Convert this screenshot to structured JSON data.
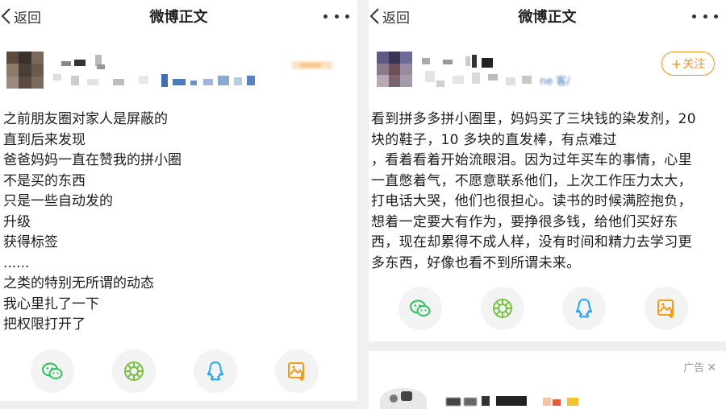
{
  "colors": {
    "accent": "#f7931e",
    "wechat": "#2cc35a",
    "moments": "#7ac142",
    "qq": "#1ea7f1",
    "save": "#f39c12"
  },
  "left": {
    "nav": {
      "back_label": "返回",
      "title": "微博正文"
    },
    "post_lines": [
      "之前朋友圈对家人是屏蔽的",
      "直到后来发现",
      "爸爸妈妈一直在赞我的拼小圈",
      "不是买的东西",
      "只是一些自动发的",
      "升级",
      "获得标签",
      "......",
      "之类的特别无所谓的动态",
      "我心里扎了一下",
      "把权限打开了"
    ],
    "share_icons": [
      "wechat-icon",
      "moments-icon",
      "qq-icon",
      "save-image-icon"
    ]
  },
  "right": {
    "nav": {
      "back_label": "返回",
      "title": "微博正文"
    },
    "follow_label": "关注",
    "follow_plus": "+",
    "source_fragment": "ne 客/",
    "post_lines": [
      "看到拼多多拼小圈里，妈妈买了三块钱的染发剂，20",
      "块的鞋子，10 多块的直发棒，有点难过",
      "，看着看着开始流眼泪。因为过年买车的事情，心里",
      "一直憋着气，不愿意联系他们，上次工作压力太大，",
      "打电话大哭，他们也很担心。读书的时候满腔抱负，",
      "想着一定要大有作为，要挣很多钱，给他们买好东",
      "西，现在却累得不成人样，没有时间和精力去学习更",
      "多东西，好像也看不到所谓未来。"
    ],
    "share_icons": [
      "wechat-icon",
      "moments-icon",
      "qq-icon",
      "save-image-icon"
    ],
    "ad": {
      "label": "广告",
      "close": "✕"
    }
  }
}
